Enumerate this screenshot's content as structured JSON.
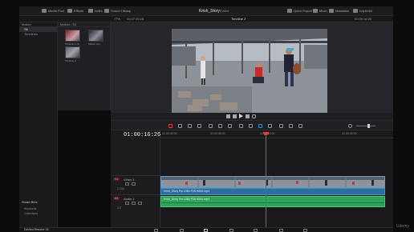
{
  "topbar": {
    "media_pool": "Media Pool",
    "effects": "Effects",
    "edit_index": "Index",
    "sound_library": "Sound Library",
    "project_title": "Krish_Story",
    "project_status": "Edited",
    "timeline_name": "Timeline 2",
    "quick_export": "Quick Export",
    "mixer": "Mixer",
    "metadata": "Metadata",
    "inspector": "Inspector"
  },
  "viewer_bar": {
    "zoom": "77%",
    "source_timecode": "00:37:25:25",
    "record_timecode": "00:00:16:26"
  },
  "sidebar": {
    "header": "Master",
    "items": [
      "Sit",
      "Timelines"
    ],
    "smart_bins_title": "Smart Bins",
    "smart_items": [
      "Keywords",
      "Collections"
    ]
  },
  "media_pool": {
    "header": "Master / Sit",
    "clips": [
      {
        "label": "Timeline 1 (2)"
      },
      {
        "label": "Master clip"
      },
      {
        "label": "Timeline 2"
      }
    ]
  },
  "timeline": {
    "timecode": "01:00:16:26",
    "ruler": [
      "01:00:00:00",
      "01:00:08:00",
      "01:00:16:00",
      "01:00:24:00"
    ],
    "tracks": [
      {
        "id": "V1",
        "name": "Video 1",
        "sub": "1 Clip",
        "color": "#d0423d"
      },
      {
        "id": "A1",
        "name": "Audio 1",
        "sub": "2.0",
        "color": "#d0423d"
      }
    ],
    "audio_clip_label": "Krish_Story Ful 1080 P25 H264.mp4",
    "audio_clip_label_lower": "Krish_Story Ful 1080 P25 H264.mp4"
  },
  "footer": {
    "app_name": "DaVinci Resolve 18"
  },
  "watermark": "Udemy",
  "colors": {
    "accent_red": "#e03a3a",
    "video_track": "#3a8ecb",
    "audio_track": "#2ea35a",
    "audio_track_dark": "#1f7a43"
  },
  "icons": [
    "media-pool-icon",
    "effects-icon",
    "index-icon",
    "sound-library-icon",
    "quick-export-icon",
    "mixer-icon",
    "metadata-icon",
    "inspector-icon",
    "play-icon",
    "stop-icon",
    "prev-icon",
    "next-icon",
    "loop-icon",
    "blade-icon",
    "link-icon",
    "flag-icon",
    "marker-icon",
    "zoom-icon",
    "volume-icon"
  ]
}
